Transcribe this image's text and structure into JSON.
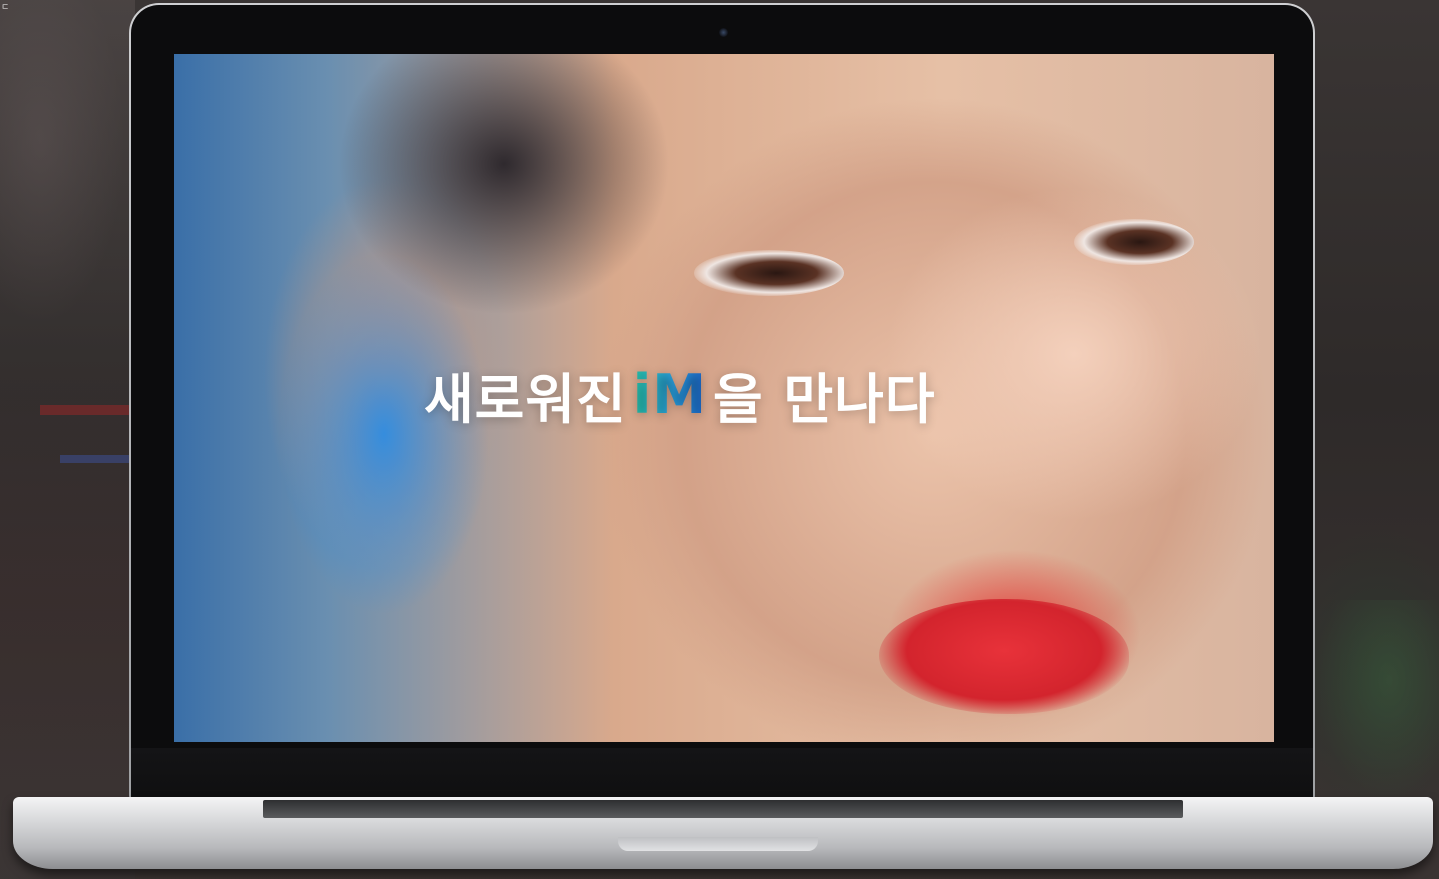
{
  "page": {
    "corner_text": "ㄷ"
  },
  "video": {
    "headline_prefix": "새로워진",
    "brand": "iM",
    "headline_suffix": "을 만나다",
    "brand_gradient": [
      "#27c2a8",
      "#2aa0e0",
      "#1b63c9"
    ]
  },
  "colors": {
    "bezel": "#0c0c0d",
    "chassis": "#d6d7d9",
    "background": "#2b2a2a"
  }
}
